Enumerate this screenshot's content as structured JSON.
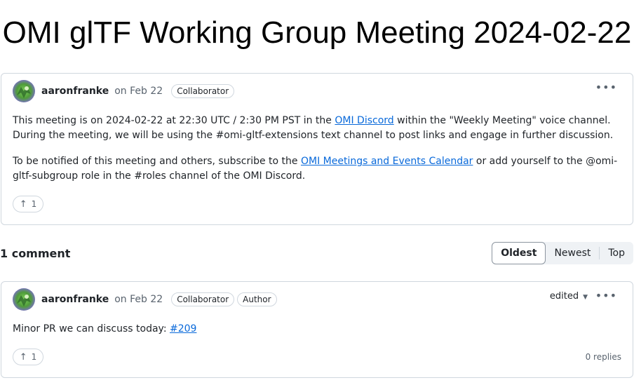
{
  "page": {
    "title": "OMI glTF Working Group Meeting 2024-02-22"
  },
  "post": {
    "author": "aaronfranke",
    "date": "on Feb 22",
    "badges": [
      "Collaborator"
    ],
    "paragraph1": {
      "before": "This meeting is on 2024-02-22 at 22:30 UTC / 2:30 PM PST in the ",
      "link": "OMI Discord",
      "after": " within the \"Weekly Meeting\" voice channel. During the meeting, we will be using the #omi-gltf-extensions text channel to post links and engage in further discussion."
    },
    "paragraph2": {
      "before": "To be notified of this meeting and others, subscribe to the ",
      "link": "OMI Meetings and Events Calendar",
      "after": " or add yourself to the @omi-gltf-subgroup role in the #roles channel of the OMI Discord."
    },
    "reaction": {
      "icon": "thumbs-up-arrow-icon",
      "count": "1"
    },
    "menu_icon": "kebab-horizontal-icon"
  },
  "comments_header": {
    "count_label": "1 comment",
    "sort_options": [
      "Oldest",
      "Newest",
      "Top"
    ],
    "selected": "Oldest"
  },
  "comment": {
    "author": "aaronfranke",
    "date": "on Feb 22",
    "badges": [
      "Collaborator",
      "Author"
    ],
    "edited_label": "edited",
    "text_before": "Minor PR we can discuss today: ",
    "link": "#209",
    "reaction": {
      "count": "1"
    },
    "replies": "0 replies"
  },
  "colors": {
    "link": "#0969da",
    "border": "#d0d7de",
    "muted": "#59636e"
  }
}
